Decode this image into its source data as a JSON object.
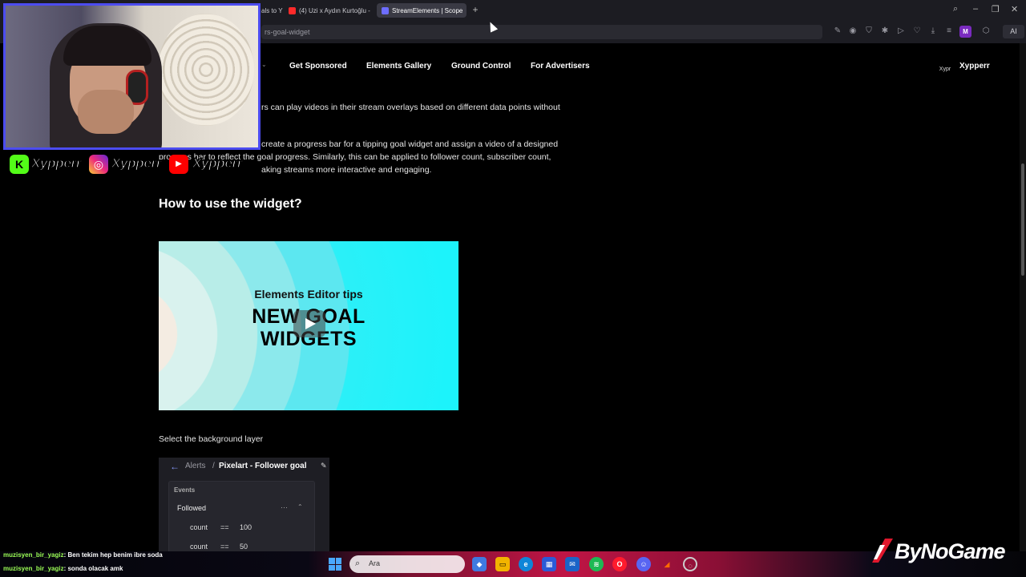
{
  "browser": {
    "tabs": [
      {
        "label": "als to Y",
        "color": "#ffffff"
      },
      {
        "label": "(4) Uzi x Aydın Kurtoğlu -",
        "color": "#ff2a2a"
      },
      {
        "label": "StreamElements | Scope",
        "color": "#ffffff"
      }
    ],
    "new_tab": "+",
    "url": "rs-goal-widget",
    "profile_initial": "M",
    "ai_label": "AI"
  },
  "site_nav": {
    "links": [
      "Get Sponsored",
      "Elements Gallery",
      "Ground Control",
      "For Advertisers"
    ],
    "user_avatar_text": "Xypr",
    "user_name": "Xypperr"
  },
  "article": {
    "para1": "rs can play videos in their stream overlays based on different data points without",
    "para2_line1": "create a progress bar for a tipping goal widget and assign a video of a designed",
    "para2_line2": "progress bar to reflect the goal progress. Similarly, this can be applied to follower count, subscriber count,",
    "para2_line3": "aking streams more interactive and engaging.",
    "heading": "How to use the widget?",
    "video_subtitle": "Elements Editor tips",
    "video_title_line1": "NEW GOAL",
    "video_title_line2": "WIDGETS",
    "bg_layer_label": "Select the background layer"
  },
  "editor": {
    "crumb_parent": "Alerts",
    "crumb_sep": "/",
    "crumb_current": "Pixelart - Follower goal",
    "section": "Events",
    "event": "Followed",
    "more": "···",
    "rows": [
      {
        "field": "count",
        "op": "==",
        "value": "100"
      },
      {
        "field": "count",
        "op": "==",
        "value": "50"
      }
    ]
  },
  "overlay": {
    "socials": [
      {
        "icon": "kick-icon",
        "name": "Xypperr",
        "color": "#53fc18"
      },
      {
        "icon": "instagram-icon",
        "name": "Xypperr",
        "color": "#d62976"
      },
      {
        "icon": "youtube-icon",
        "name": "Xypperr",
        "color": "#ff0000"
      }
    ],
    "chat": [
      {
        "user": "muzisyen_bir_yagiz",
        "msg": ": Ben tekim hep benim ibre soda"
      },
      {
        "user": "muzisyen_bir_yagiz",
        "msg": ": sonda olacak amk"
      }
    ],
    "sponsor": "ByNoGame"
  },
  "taskbar": {
    "search_placeholder": "Ara"
  }
}
